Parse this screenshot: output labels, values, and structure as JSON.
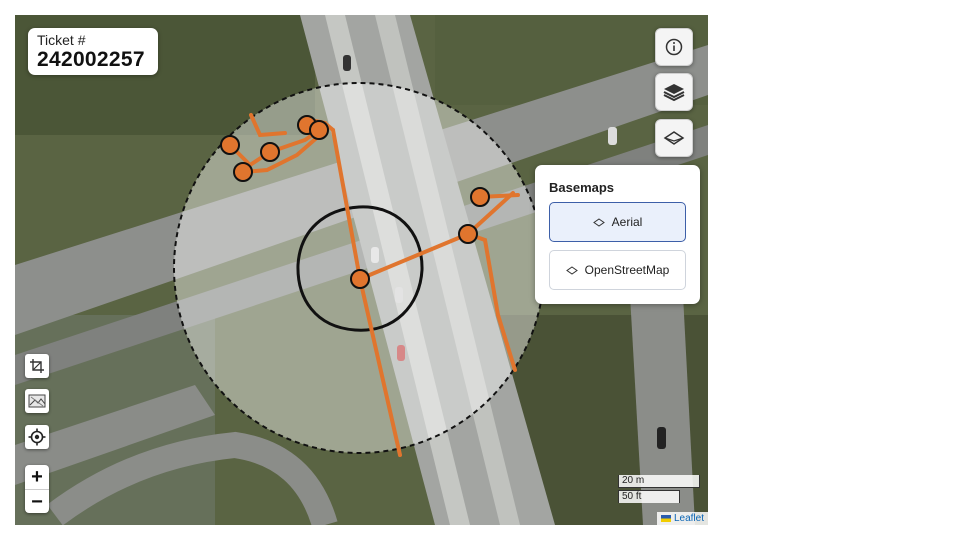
{
  "ticket": {
    "label": "Ticket #",
    "number": "242002257"
  },
  "controls": {
    "info_icon": "info-icon",
    "layers_icon": "layers-icon",
    "basemap_icon": "basemap-toggle-icon"
  },
  "basemaps": {
    "title": "Basemaps",
    "options": [
      {
        "label": "Aerial",
        "selected": true
      },
      {
        "label": "OpenStreetMap",
        "selected": false
      }
    ]
  },
  "left_tools": [
    "crop-icon",
    "map-image-icon",
    "locate-icon"
  ],
  "zoom": {
    "in": "+",
    "out": "−"
  },
  "scale": {
    "metric": "20 m",
    "imperial": "50 ft"
  },
  "attribution": "Leaflet",
  "colors": {
    "line": "#e0752e",
    "circle_fill": "rgba(255,255,255,0.42)",
    "panel_active": "#eaf0fb",
    "panel_border": "#3d5fa8"
  }
}
